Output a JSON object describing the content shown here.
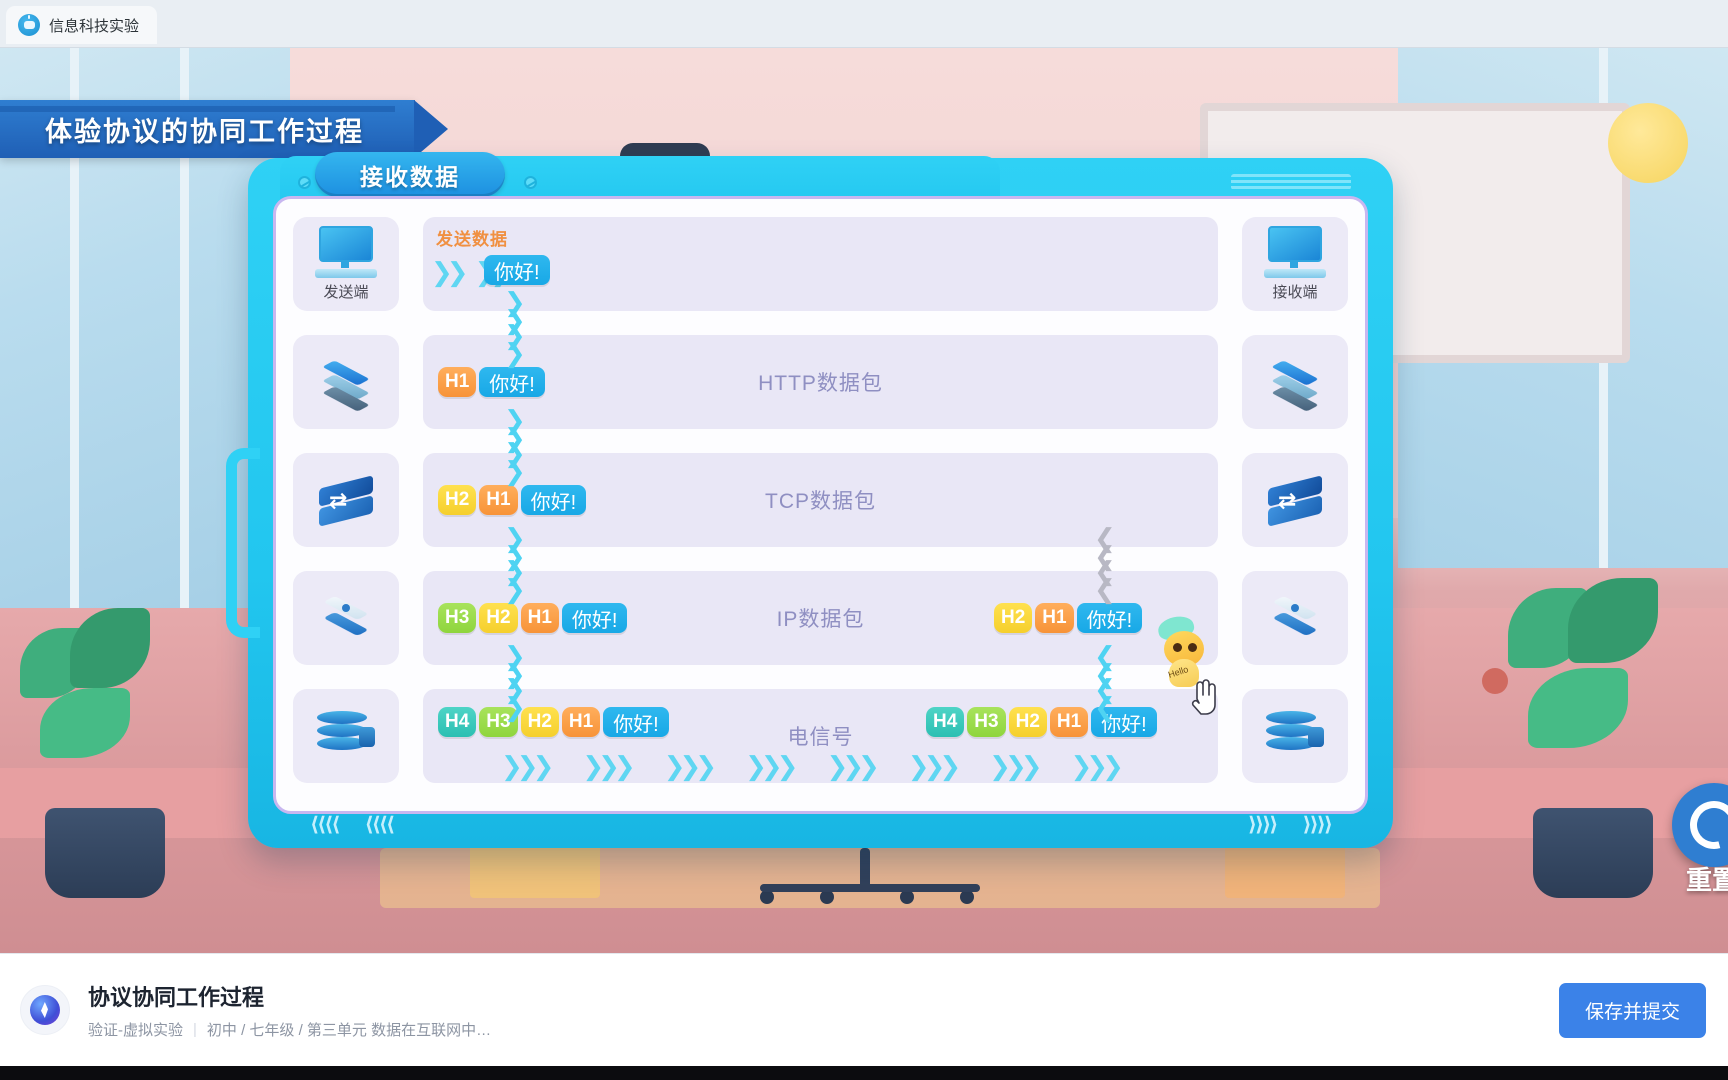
{
  "browser": {
    "tab_title": "信息科技实验",
    "favicon_name": "ai-robot-icon"
  },
  "banner": {
    "title": "体验协议的协同工作过程"
  },
  "device": {
    "tab_label": "接收数据",
    "foot_left": [
      "⟨⟨⟨⟨",
      "⟨⟨⟨⟨"
    ],
    "foot_right": [
      "⟩⟩⟩⟩",
      "⟩⟩⟩⟩"
    ]
  },
  "diagram": {
    "send_label": "发送数据",
    "sender_label": "发送端",
    "receiver_label": "接收端",
    "message": "你好!",
    "rows": [
      {
        "id": "application-endpoint",
        "track_name": "",
        "left_icon": "computer-icon",
        "right_icon": "computer-icon",
        "left_packet": [],
        "right_packet": []
      },
      {
        "id": "http-layer",
        "track_name": "HTTP数据包",
        "left_icon": "layer-stack-icon",
        "right_icon": "layer-stack-icon",
        "left_packet": [
          "H1"
        ],
        "right_packet": []
      },
      {
        "id": "tcp-layer",
        "track_name": "TCP数据包",
        "left_icon": "switch-icon",
        "right_icon": "switch-icon",
        "left_packet": [
          "H2",
          "H1"
        ],
        "right_packet": []
      },
      {
        "id": "ip-layer",
        "track_name": "IP数据包",
        "left_icon": "router-icon",
        "right_icon": "router-icon",
        "left_packet": [
          "H3",
          "H2",
          "H1"
        ],
        "right_packet": [
          "H2",
          "H1"
        ]
      },
      {
        "id": "physical-layer",
        "track_name": "电信号",
        "left_icon": "database-icon",
        "right_icon": "database-icon",
        "left_packet": [
          "H4",
          "H3",
          "H2",
          "H1"
        ],
        "right_packet": [
          "H4",
          "H3",
          "H2",
          "H1"
        ]
      }
    ],
    "chip_colors": {
      "H1": "#f79338",
      "H2": "#f5cf2c",
      "H3": "#8fd53d",
      "H4": "#2bbfb2",
      "message": "#18a8e6"
    },
    "mascot_label": "Hello"
  },
  "reset": {
    "label": "重置",
    "icon": "reset-circle-icon"
  },
  "bottom": {
    "title": "协议协同工作过程",
    "meta_type": "验证-虚拟实验",
    "meta_path": "初中 / 七年级 / 第三单元 数据在互联网中…",
    "save_button": "保存并提交"
  }
}
